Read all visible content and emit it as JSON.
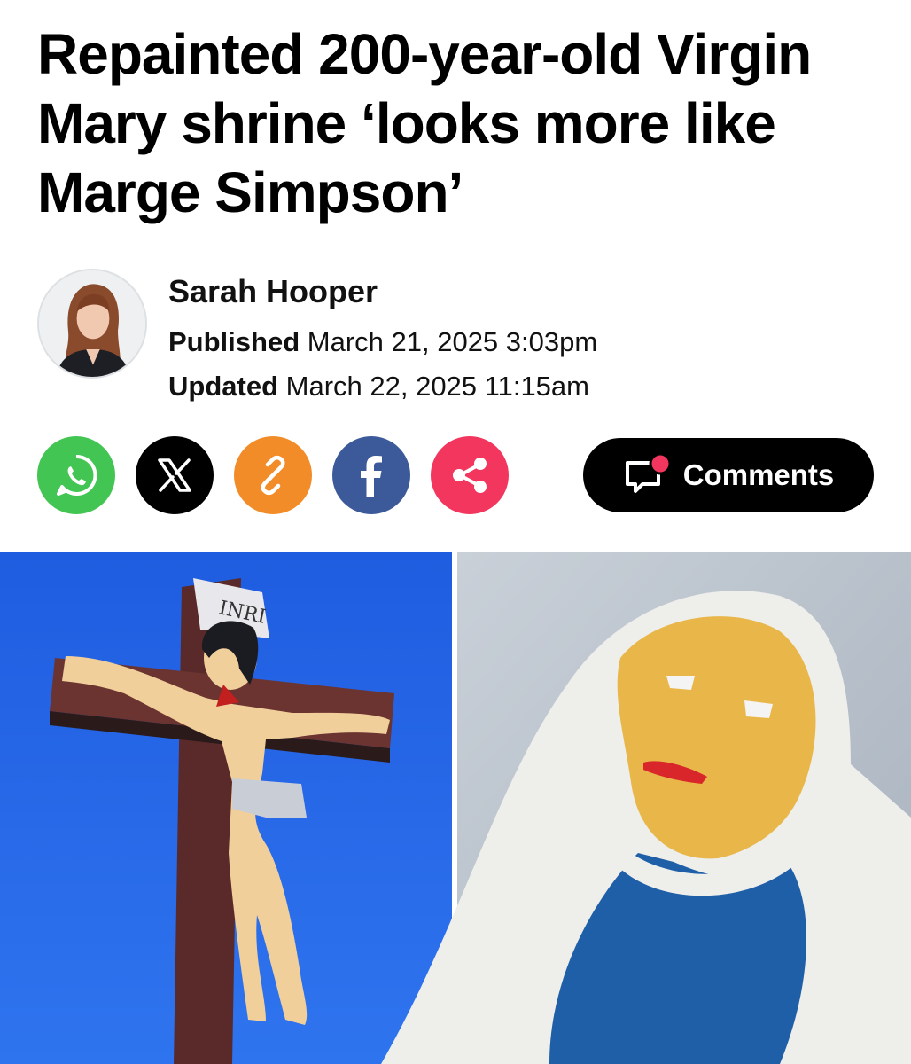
{
  "article": {
    "headline": "Repainted 200-year-old Virgin Mary shrine ‘looks more like Marge Simpson’",
    "author": "Sarah Hooper",
    "published_label": "Published",
    "published_value": "March 21, 2025 3:03pm",
    "updated_label": "Updated",
    "updated_value": "March 22, 2025 11:15am"
  },
  "share": {
    "buttons": [
      {
        "icon": "whatsapp-icon",
        "color": "#43c553"
      },
      {
        "icon": "x-icon",
        "color": "#000000"
      },
      {
        "icon": "link-icon",
        "color": "#f28c28"
      },
      {
        "icon": "facebook-icon",
        "color": "#3c5a9a"
      },
      {
        "icon": "share-icon",
        "color": "#f2365d"
      }
    ],
    "comments_label": "Comments",
    "comments_badge_color": "#f2365d"
  },
  "photo": {
    "cross_plaque_text": "INRI"
  }
}
